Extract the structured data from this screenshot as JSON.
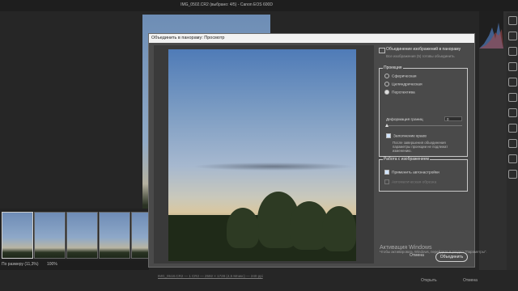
{
  "app": {
    "window_title": "IMG_0502.CR2 (выбрано: 4/5) - Canon EOS 600D",
    "filename_bar": "IMG_0518.CR2 — 1 CR2 — 2592 × 1728 (4,5 Мпикс) — 240 ppi",
    "open_label": "Открыть",
    "cancel_label": "Отмена",
    "zoom_label": "По размеру (11,3%)",
    "zoom_pct": "100%"
  },
  "dialog": {
    "title": "Объединить в панораму: Просмотр",
    "merge_heading": "Объединение изображений в панораму",
    "merge_sub": "Все изображения (5) готовы объединить",
    "projection": {
      "title": "Проекция",
      "options": [
        "Сферическая",
        "Цилиндрическая",
        "Перспектива"
      ],
      "selected": "Перспектива"
    },
    "boundary_label": "Деформация границ",
    "boundary_value": "0",
    "fill_edges_label": "Заполнение краев",
    "fill_note": "После завершения объединения параметры проекции не подлежат изменению.",
    "image_group": {
      "title": "Работа с изображением",
      "auto_settings": "Применить автонастройки",
      "auto_crop": "Автоматическая обрезка"
    },
    "cancel_button": "Отмена",
    "merge_button": "Объединить"
  },
  "watermark": {
    "title": "Активация Windows",
    "text": "Чтобы активировать Windows, перейдите в раздел \"Параметры\"."
  },
  "colors": {
    "dialog_bg": "#4a4a4a",
    "app_bg": "#262626"
  }
}
